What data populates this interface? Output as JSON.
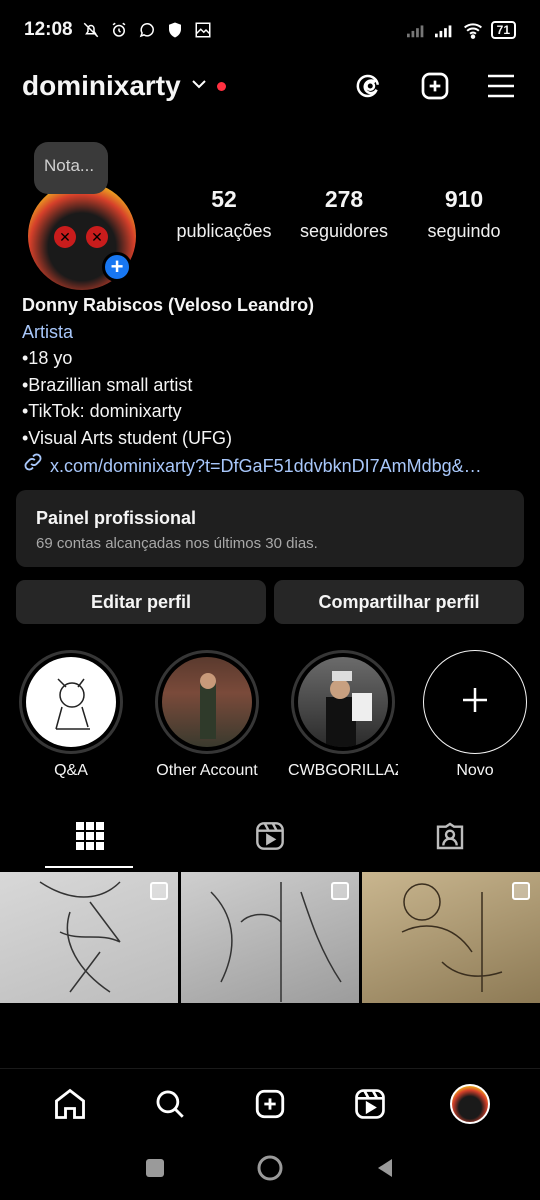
{
  "status": {
    "time": "12:08",
    "battery": "71"
  },
  "header": {
    "username": "dominixarty"
  },
  "note": {
    "text": "Nota..."
  },
  "stats": [
    {
      "value": "52",
      "label": "publicações"
    },
    {
      "value": "278",
      "label": "seguidores"
    },
    {
      "value": "910",
      "label": "seguindo"
    }
  ],
  "bio": {
    "name": "Donny Rabiscos (Veloso Leandro)",
    "category": "Artista",
    "lines": [
      "•18 yo",
      "•Brazillian small artist",
      "•TikTok: dominixarty",
      "•Visual Arts student  (UFG)"
    ],
    "link": "x.com/dominixarty?t=DfGaF51ddvbknDI7AmMdbg&…"
  },
  "dashboard": {
    "title": "Painel profissional",
    "subtitle": "69 contas alcançadas nos últimos 30 dias."
  },
  "buttons": {
    "edit": "Editar perfil",
    "share": "Compartilhar perfil"
  },
  "highlights": [
    {
      "label": "Q&A"
    },
    {
      "label": "Other Account"
    },
    {
      "label": "CWBGORILLAZ(..."
    },
    {
      "label": "Novo"
    }
  ],
  "colors": {
    "accent_link": "#a8c7fa",
    "live_dot": "#ff3040",
    "add_blue": "#1877f2"
  }
}
